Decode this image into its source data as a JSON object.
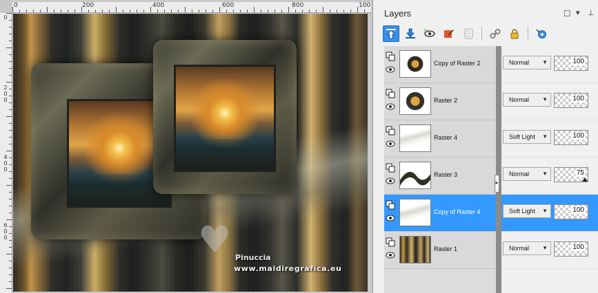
{
  "ruler": {
    "top_labels": [
      "0",
      "200",
      "400",
      "600",
      "800",
      "100"
    ],
    "left_labels": [
      "0",
      "200",
      "400",
      "600"
    ]
  },
  "watermark": {
    "name": "Pinuccia",
    "url": "www.maidiregrafica.eu"
  },
  "layers_palette": {
    "title": "Layers",
    "window_buttons": {
      "maximize": "□",
      "menu": "▾",
      "pin": "⊥"
    },
    "toolbar_icons": [
      "move-layer-up-icon",
      "move-layer-down-icon",
      "visibility-toggle-icon",
      "edit-selection-icon",
      "mask-icon",
      "link-icon",
      "lock-icon",
      "layer-properties-icon"
    ],
    "active_toolbar_icon": "move-layer-up-icon",
    "selected_layer": "Copy of Raster 4",
    "layers": [
      {
        "name": "Copy of Raster 2",
        "blend_mode": "Normal",
        "opacity": "100"
      },
      {
        "name": "Raster 2",
        "blend_mode": "Normal",
        "opacity": "100"
      },
      {
        "name": "Raster 4",
        "blend_mode": "Soft Light",
        "opacity": "100"
      },
      {
        "name": "Raster 3",
        "blend_mode": "Normal",
        "opacity": "75"
      },
      {
        "name": "Copy of Raster 4",
        "blend_mode": "Soft Light",
        "opacity": "100"
      },
      {
        "name": "Raster 1",
        "blend_mode": "Normal",
        "opacity": "100"
      }
    ]
  },
  "colors": {
    "selection": "#3399ff",
    "active_tool": "#3a8ee6"
  }
}
